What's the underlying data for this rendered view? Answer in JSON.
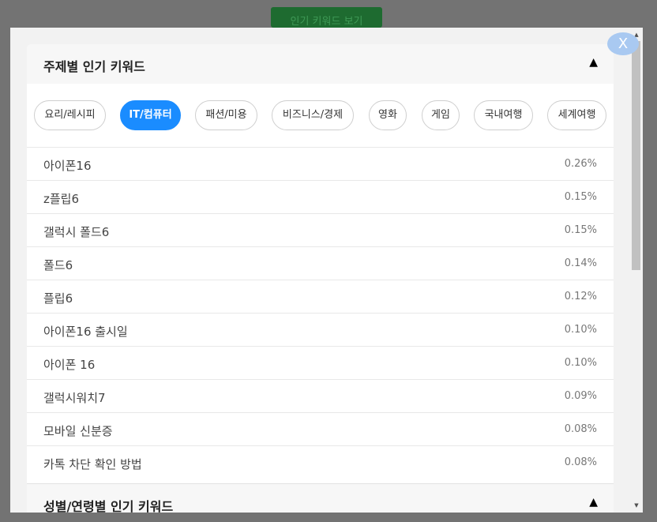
{
  "background_button": {
    "label": "인기 키워드 보기"
  },
  "modal": {
    "close_label": "X",
    "section1": {
      "title": "주제별 인기 키워드",
      "toggle": "▲",
      "categories": [
        {
          "label": "요리/레시피",
          "active": false
        },
        {
          "label": "IT/컴퓨터",
          "active": true
        },
        {
          "label": "패션/미용",
          "active": false
        },
        {
          "label": "비즈니스/경제",
          "active": false
        },
        {
          "label": "영화",
          "active": false
        },
        {
          "label": "게임",
          "active": false
        },
        {
          "label": "국내여행",
          "active": false
        },
        {
          "label": "세계여행",
          "active": false
        }
      ],
      "keywords": [
        {
          "keyword": "아이폰16",
          "share": "0.26%"
        },
        {
          "keyword": "z플립6",
          "share": "0.15%"
        },
        {
          "keyword": "갤럭시 폴드6",
          "share": "0.15%"
        },
        {
          "keyword": "폴드6",
          "share": "0.14%"
        },
        {
          "keyword": "플립6",
          "share": "0.12%"
        },
        {
          "keyword": "아이폰16 출시일",
          "share": "0.10%"
        },
        {
          "keyword": "아이폰 16",
          "share": "0.10%"
        },
        {
          "keyword": "갤럭시워치7",
          "share": "0.09%"
        },
        {
          "keyword": "모바일 신분증",
          "share": "0.08%"
        },
        {
          "keyword": "카톡 차단 확인 방법",
          "share": "0.08%"
        }
      ]
    },
    "section2": {
      "title": "성별/연령별 인기 키워드",
      "toggle": "▲"
    }
  },
  "scrollbar": {
    "up_glyph": "▲",
    "down_glyph": "▼"
  },
  "colors": {
    "overlay": "#737373",
    "accent": "#1a8cff",
    "background_button": "#1e6b30",
    "close_button": "#a9c9f1"
  }
}
